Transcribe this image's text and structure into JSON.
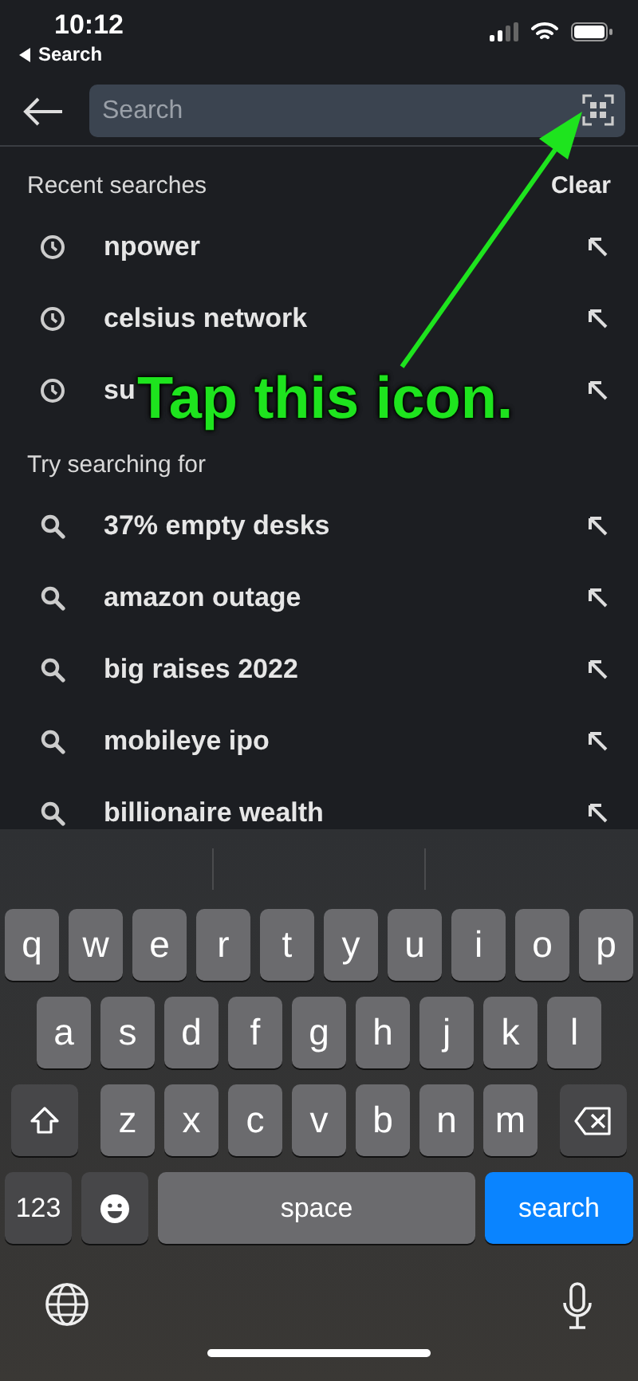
{
  "status_bar": {
    "time": "10:12",
    "back_link": "Search"
  },
  "search": {
    "placeholder": "Search"
  },
  "recent": {
    "title": "Recent searches",
    "clear": "Clear",
    "items": [
      {
        "text": "npower"
      },
      {
        "text": "celsius network"
      },
      {
        "text": "su"
      }
    ]
  },
  "suggestions": {
    "title": "Try searching for",
    "items": [
      {
        "text": "37% empty desks"
      },
      {
        "text": "amazon outage"
      },
      {
        "text": "big raises 2022"
      },
      {
        "text": "mobileye ipo"
      },
      {
        "text": "billionaire wealth"
      }
    ]
  },
  "keyboard": {
    "letter_rows": [
      [
        {
          "kind": "letter",
          "label": "q"
        },
        {
          "kind": "letter",
          "label": "w"
        },
        {
          "kind": "letter",
          "label": "e"
        },
        {
          "kind": "letter",
          "label": "r"
        },
        {
          "kind": "letter",
          "label": "t"
        },
        {
          "kind": "letter",
          "label": "y"
        },
        {
          "kind": "letter",
          "label": "u"
        },
        {
          "kind": "letter",
          "label": "i"
        },
        {
          "kind": "letter",
          "label": "o"
        },
        {
          "kind": "letter",
          "label": "p"
        }
      ],
      [
        {
          "kind": "letter",
          "label": "a"
        },
        {
          "kind": "letter",
          "label": "s"
        },
        {
          "kind": "letter",
          "label": "d"
        },
        {
          "kind": "letter",
          "label": "f"
        },
        {
          "kind": "letter",
          "label": "g"
        },
        {
          "kind": "letter",
          "label": "h"
        },
        {
          "kind": "letter",
          "label": "j"
        },
        {
          "kind": "letter",
          "label": "k"
        },
        {
          "kind": "letter",
          "label": "l"
        }
      ],
      [
        {
          "kind": "shift"
        },
        {
          "kind": "letter",
          "label": "z"
        },
        {
          "kind": "letter",
          "label": "x"
        },
        {
          "kind": "letter",
          "label": "c"
        },
        {
          "kind": "letter",
          "label": "v"
        },
        {
          "kind": "letter",
          "label": "b"
        },
        {
          "kind": "letter",
          "label": "n"
        },
        {
          "kind": "letter",
          "label": "m"
        },
        {
          "kind": "delete"
        }
      ]
    ],
    "bottom_row": [
      {
        "kind": "numbers",
        "label": "123"
      },
      {
        "kind": "emoji"
      },
      {
        "kind": "space",
        "label": "space"
      },
      {
        "kind": "action",
        "label": "search"
      }
    ]
  },
  "annotation": {
    "text": "Tap this icon."
  }
}
